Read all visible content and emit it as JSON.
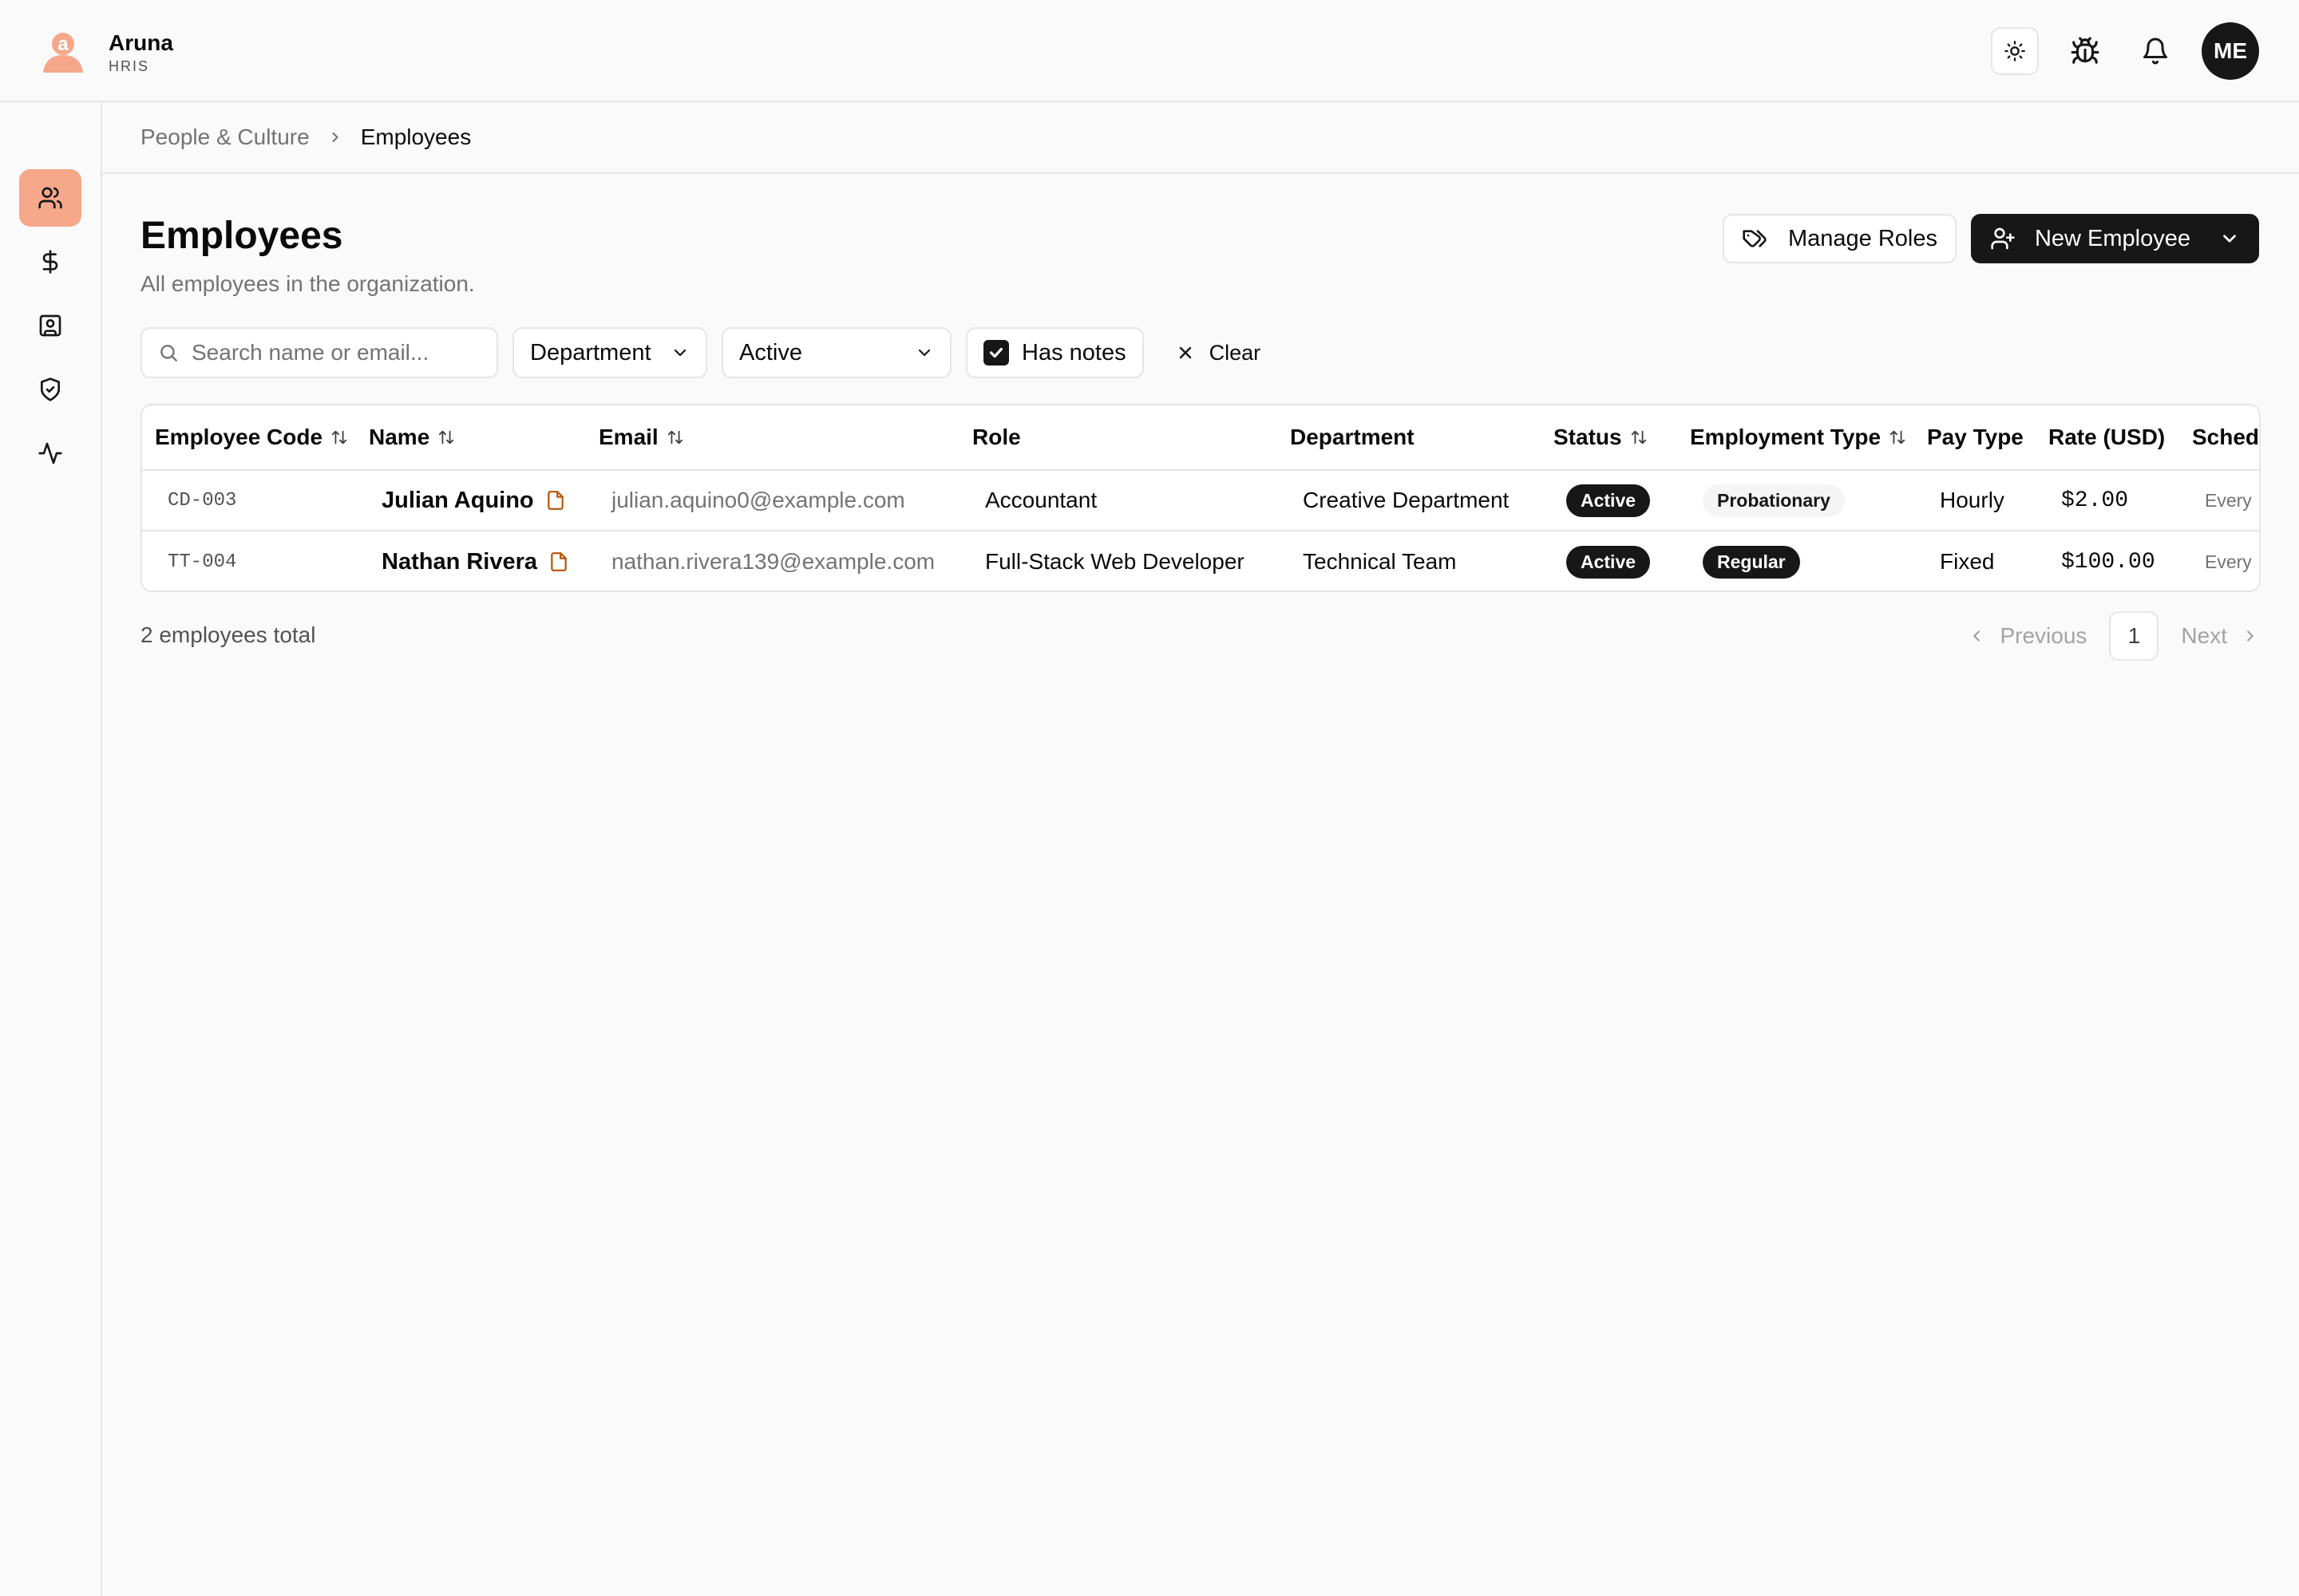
{
  "app": {
    "name": "Aruna",
    "subtitle": "HRIS"
  },
  "topbar": {
    "icons": [
      "sun-icon",
      "bug-icon",
      "bell-icon"
    ],
    "avatar_initials": "ME"
  },
  "sidebar": {
    "items": [
      {
        "icon": "users-icon",
        "active": true
      },
      {
        "icon": "dollar-icon",
        "active": false
      },
      {
        "icon": "contact-card-icon",
        "active": false
      },
      {
        "icon": "shield-check-icon",
        "active": false
      },
      {
        "icon": "activity-icon",
        "active": false
      }
    ]
  },
  "breadcrumb": {
    "parent": "People & Culture",
    "current": "Employees"
  },
  "page": {
    "title": "Employees",
    "subtitle": "All employees in the organization."
  },
  "actions": {
    "manage_roles": "Manage Roles",
    "new_employee": "New Employee"
  },
  "filters": {
    "search_placeholder": "Search name or email...",
    "department": "Department",
    "status": "Active",
    "has_notes": "Has notes",
    "has_notes_checked": true,
    "clear": "Clear"
  },
  "table": {
    "headers": {
      "code": "Employee Code",
      "name": "Name",
      "email": "Email",
      "role": "Role",
      "department": "Department",
      "status": "Status",
      "employment_type": "Employment Type",
      "pay_type": "Pay Type",
      "rate": "Rate (USD)",
      "schedule": "Sched"
    },
    "rows": [
      {
        "code": "CD-003",
        "name": "Julian Aquino",
        "email": "julian.aquino0@example.com",
        "role": "Accountant",
        "department": "Creative Department",
        "status": "Active",
        "employment_type": "Probationary",
        "pay_type": "Hourly",
        "rate": "$2.00",
        "schedule": "Every"
      },
      {
        "code": "TT-004",
        "name": "Nathan Rivera",
        "email": "nathan.rivera139@example.com",
        "role": "Full-Stack Web Developer",
        "department": "Technical Team",
        "status": "Active",
        "employment_type": "Regular",
        "pay_type": "Fixed",
        "rate": "$100.00",
        "schedule": "Every"
      }
    ]
  },
  "footer": {
    "total": "2 employees total",
    "previous": "Previous",
    "page": "1",
    "next": "Next"
  },
  "colors": {
    "brand": "#f7a78a",
    "note_icon": "#b45309",
    "dark": "#171717"
  }
}
